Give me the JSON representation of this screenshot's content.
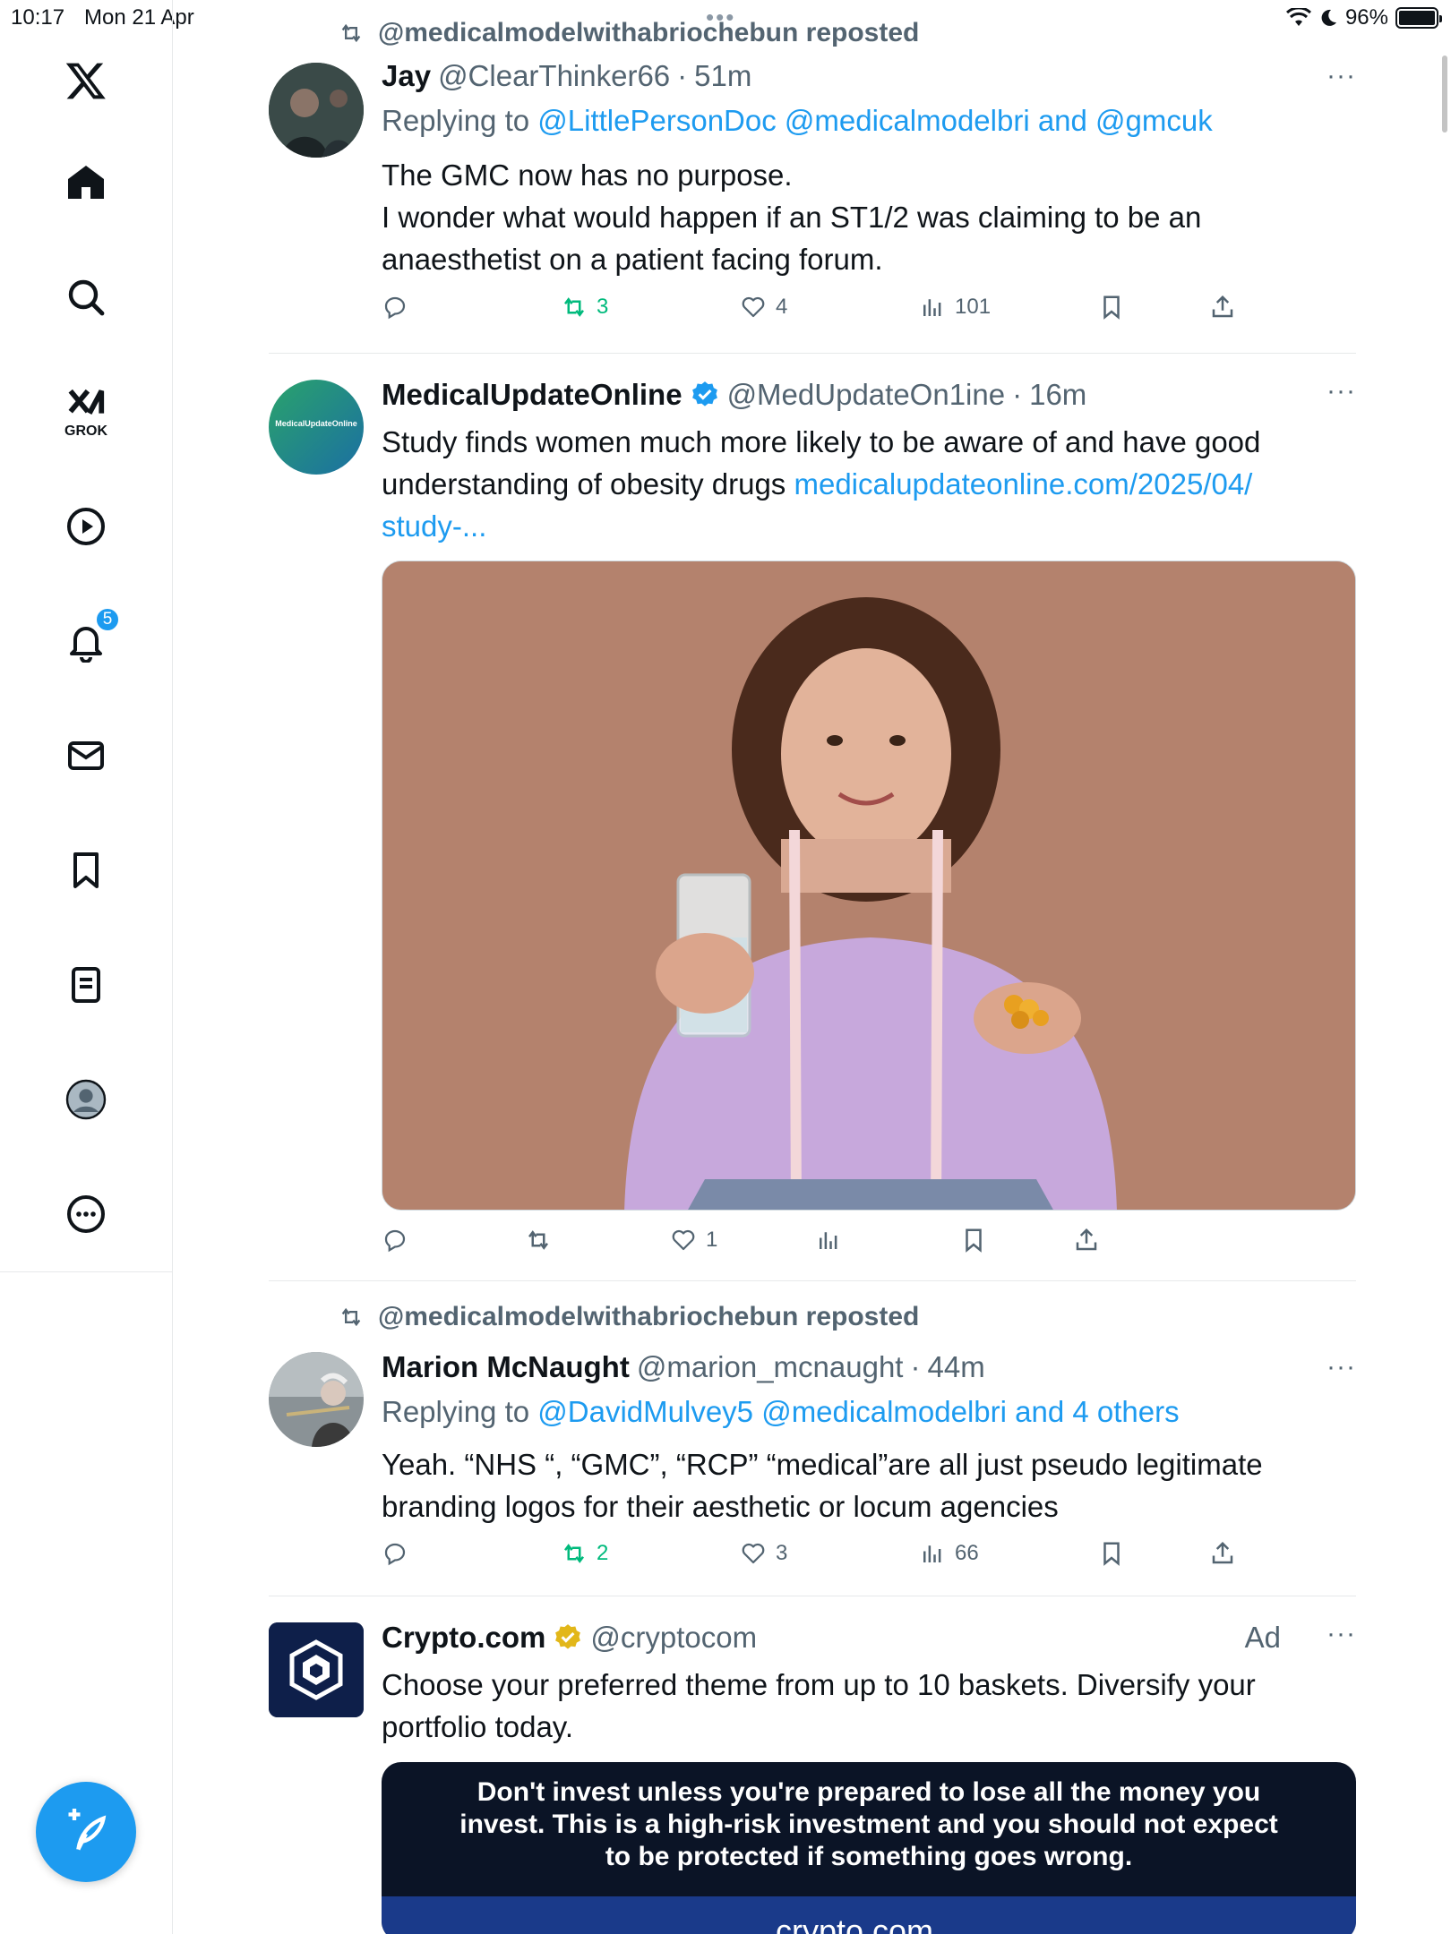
{
  "status_bar": {
    "time": "10:17",
    "date": "Mon 21 Apr",
    "battery": "96%"
  },
  "sidebar": {
    "notifications_badge": "5",
    "grok_label": "GROK",
    "items": [
      "x-logo",
      "home",
      "search",
      "grok",
      "video",
      "notifications",
      "messages",
      "bookmarks",
      "lists",
      "profile",
      "more"
    ]
  },
  "feed": {
    "tweets": [
      {
        "repost_text": "@medicalmodelwithabriochebun reposted",
        "name": "Jay",
        "handle": "@ClearThinker66",
        "sep": "·",
        "time": "51m",
        "replying_label": "Replying to",
        "replying_to": "@LittlePersonDoc @medicalmodelbri and @gmcuk",
        "text_lines": [
          "The GMC now has no purpose.",
          "I wonder what would happen if an ST1/2 was claiming to be an",
          "anaesthetist on a patient facing forum."
        ],
        "retweets": "3",
        "likes": "4",
        "views": "101",
        "more": "···"
      },
      {
        "name": "MedicalUpdateOnline",
        "handle": "@MedUpdateOn1ine",
        "sep": "·",
        "time": "16m",
        "avatar_text": "MedicalUpdateOnline",
        "text_lines": [
          "Study finds women much more likely to be aware of and have good",
          "understanding of obesity drugs "
        ],
        "link_part1": "medicalupdateonline.com/2025/04/",
        "link_part2": "study-...",
        "retweets": "",
        "likes": "1",
        "views": "",
        "more": "···"
      },
      {
        "repost_text": "@medicalmodelwithabriochebun reposted",
        "name": "Marion McNaught",
        "handle": "@marion_mcnaught",
        "sep": "·",
        "time": "44m",
        "replying_label": "Replying to",
        "replying_to": "@DavidMulvey5 @medicalmodelbri and 4 others",
        "text_lines": [
          "Yeah. “NHS “, “GMC”, “RCP” “medical”are all just pseudo legitimate",
          "branding logos for their aesthetic or locum agencies"
        ],
        "retweets": "2",
        "likes": "3",
        "views": "66",
        "more": "···"
      },
      {
        "name": "Crypto.com",
        "handle": "@cryptocom",
        "ad_label": "Ad",
        "text_lines": [
          "Choose your preferred theme from up to 10 baskets. Diversify your",
          "portfolio today."
        ],
        "ad_warning": "Don't invest unless you're prepared to lose all the money you invest. This is a high-risk investment and you should not expect to be protected if something goes wrong.",
        "ad_brand": "crypto.com",
        "more": "···"
      }
    ]
  },
  "colors": {
    "accent": "#1d9bf0",
    "retweet_green": "#00ba7c",
    "secondary_text": "#536471",
    "photo_background": "#b4826d",
    "ad_dark": "#0b1426"
  }
}
